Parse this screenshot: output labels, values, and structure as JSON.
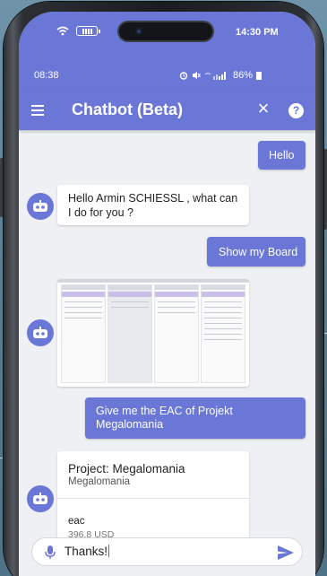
{
  "ios_status": {
    "time": "14:30 PM"
  },
  "android_status": {
    "time": "08:38",
    "battery": "86%"
  },
  "app_bar": {
    "title": "Chatbot (Beta)",
    "close_glyph": "×",
    "help_glyph": "?"
  },
  "messages": {
    "m1": "Hello",
    "m2": "Hello Armin SCHIESSL , what can I do for you ?",
    "m3": "Show my Board",
    "m5": "Give me the EAC of Projekt Megalomania"
  },
  "project_card": {
    "title": "Project: Megalomania",
    "subtitle": "Megalomania",
    "field_label": "eac",
    "field_value": "396,8 USD"
  },
  "input": {
    "value": "Thanks!"
  },
  "colors": {
    "accent": "#6b77d6",
    "background": "#eef0f3"
  },
  "icons": [
    "wifi-icon",
    "battery-icon",
    "alarm-icon",
    "signal-icon",
    "menu-icon",
    "close-icon",
    "help-icon",
    "robot-icon",
    "mic-icon",
    "send-icon"
  ]
}
